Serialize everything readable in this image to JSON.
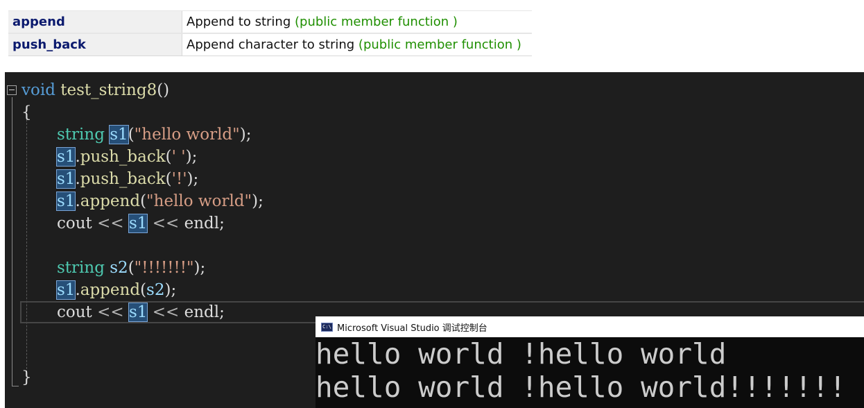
{
  "reference": {
    "rows": [
      {
        "name": "append",
        "desc": "Append to string",
        "tag": "(public member function )"
      },
      {
        "name": "push_back",
        "desc": "Append character to string",
        "tag": "(public member function )"
      }
    ]
  },
  "code": {
    "l1": {
      "kw": "void",
      "fn": "test_string8",
      "p": "()"
    },
    "l2": {
      "brace": "{"
    },
    "l3": {
      "ty": "string",
      "var": "s1",
      "p1": "(",
      "str": "\"hello world\"",
      "p2": ");"
    },
    "l4": {
      "var": "s1",
      "p1": ".",
      "fn": "push_back",
      "p2": "(",
      "str": "' '",
      "p3": ");"
    },
    "l5": {
      "var": "s1",
      "p1": ".",
      "fn": "push_back",
      "p2": "(",
      "str": "'!'",
      "p3": ");"
    },
    "l6": {
      "var": "s1",
      "p1": ".",
      "fn": "append",
      "p2": "(",
      "str": "\"hello world\"",
      "p3": ");"
    },
    "l7": {
      "a": "cout",
      "op1": " << ",
      "var": "s1",
      "op2": " << ",
      "b": "endl",
      "p": ";"
    },
    "l9": {
      "ty": "string",
      "var": "s2",
      "p1": "(",
      "str": "\"!!!!!!!\"",
      "p2": ");"
    },
    "l10": {
      "var": "s1",
      "p1": ".",
      "fn": "append",
      "p2": "(",
      "var2": "s2",
      "p3": ");"
    },
    "l11": {
      "a": "cout",
      "op1": " << ",
      "var": "s1",
      "op2": " << ",
      "b": "endl",
      "p": ";"
    },
    "l14": {
      "brace": "}"
    }
  },
  "console": {
    "title": "Microsoft Visual Studio 调试控制台",
    "icon_text": "C:\\",
    "lines": [
      "hello world !hello world",
      "hello world !hello world!!!!!!!"
    ]
  }
}
